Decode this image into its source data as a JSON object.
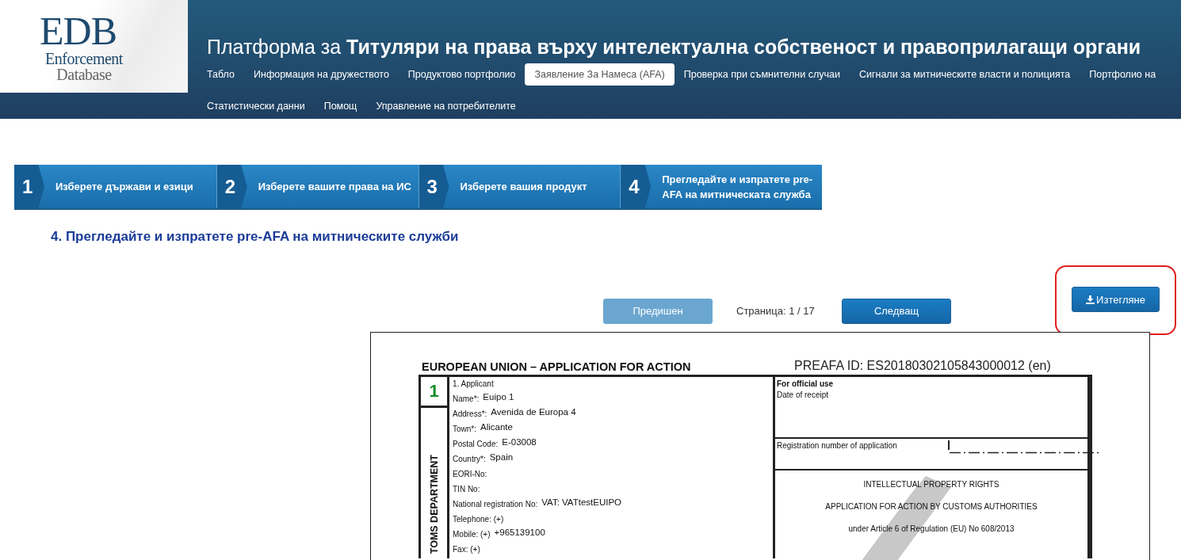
{
  "header": {
    "logo": {
      "mark": "EDB",
      "line_1": "Enforcement",
      "line_2": "Database"
    },
    "title": "Платформа за **Титуляри на права върху интелектуална собственост и правоприлагащи органи**",
    "nav_rows": [
      [
        {
          "label": "Табло",
          "selected": false
        },
        {
          "label": "Информация на дружеството",
          "selected": false
        },
        {
          "label": "Продуктово портфолио",
          "selected": false
        },
        {
          "label": "Заявление За Намеса (AFA)",
          "selected": true
        },
        {
          "label": "Проверка при съмнителни случаи",
          "selected": false
        },
        {
          "label": "Сигнали за митническите власти и полицията",
          "selected": false
        },
        {
          "label": "Портфолио на",
          "selected": false
        }
      ],
      [
        {
          "label": "Статистически данни",
          "selected": false
        },
        {
          "label": "Помощ",
          "selected": false
        },
        {
          "label": "Управление на потребителите",
          "selected": false
        }
      ]
    ]
  },
  "steps": [
    {
      "number": "1",
      "label": "Изберете държави и езици"
    },
    {
      "number": "2",
      "label": "Изберете вашите права на ИС"
    },
    {
      "number": "3",
      "label": "Изберете вашия продукт"
    },
    {
      "number": "4",
      "label": "Прегледайте и изпратете pre-AFA на митническата служба"
    }
  ],
  "heading": "4. Прегледайте и изпратете pre-AFA на митническите служби",
  "pager": {
    "previous": {
      "label": "Предишен",
      "disabled": true
    },
    "page_info": "Страница: 1 / 17",
    "next": {
      "label": "Следващ",
      "disabled": false
    },
    "download": {
      "label": "Изтегляне",
      "highlighted": true
    }
  },
  "document": {
    "title": "EUROPEAN UNION – APPLICATION FOR ACTION",
    "preafa_id": "PREAFA ID: ES20180302105843000012 (en)",
    "applicant": {
      "section_number": "1",
      "side_label": "TOMS DEPARTMENT",
      "heading": "1. Applicant",
      "fields": [
        {
          "label": "Name*:",
          "value": "Euipo 1"
        },
        {
          "label": "Address*:",
          "value": "Avenida de Europa 4"
        },
        {
          "label": "Town*:",
          "value": "Alicante"
        },
        {
          "label": "Postal Code:",
          "value": "E-03008"
        },
        {
          "label": "Country*:",
          "value": "Spain"
        },
        {
          "label": "EORI-No:"
        },
        {
          "label": "TIN No:"
        },
        {
          "label": "National registration No:",
          "value": "VAT: VATtestEUIPO"
        },
        {
          "label": "Telephone: (+)"
        },
        {
          "label": "Mobile: (+)",
          "value": "+965139100"
        },
        {
          "label": "Fax: (+)"
        }
      ]
    },
    "official": {
      "heading": "For official use",
      "date_label": "Date of receipt",
      "registration_label": "Registration number of application",
      "lines": [
        "INTELLECTUAL PROPERTY RIGHTS",
        "APPLICATION FOR ACTION BY CUSTOMS AUTHORITIES",
        "under Article 6 of Regulation (EU) No 608/2013"
      ]
    }
  }
}
